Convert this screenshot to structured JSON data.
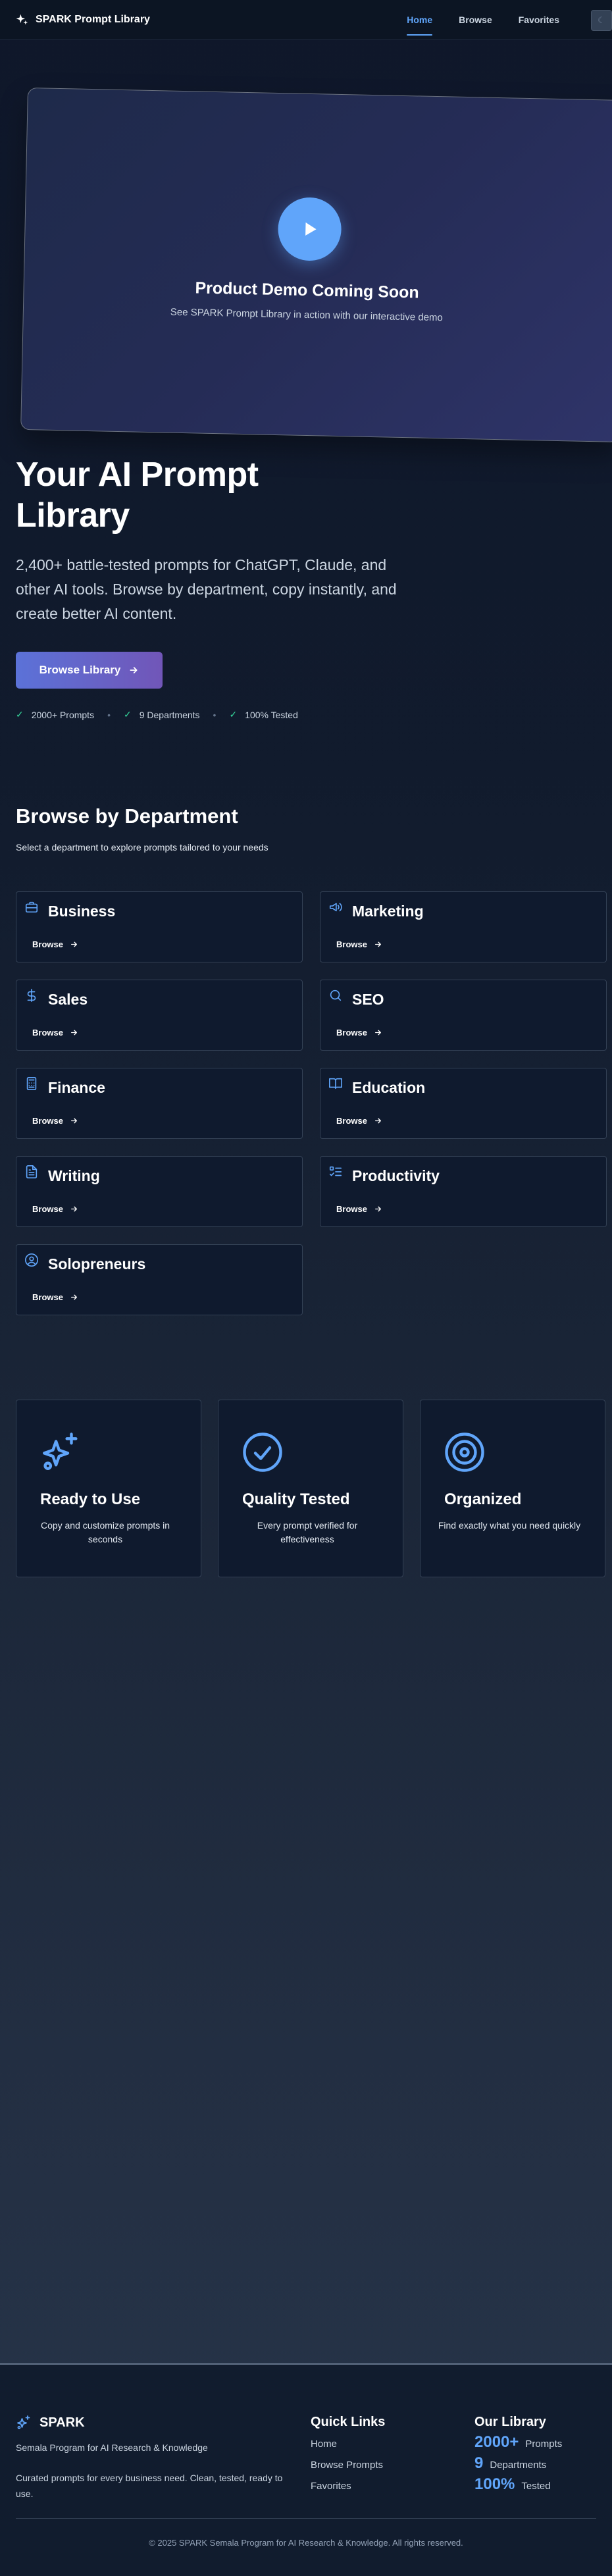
{
  "header": {
    "brand": "SPARK Prompt Library",
    "nav": [
      "Home",
      "Browse",
      "Favorites"
    ],
    "active_nav": "Home",
    "theme_icon": "moon-icon"
  },
  "demo": {
    "title": "Product Demo Coming Soon",
    "subtitle": "See SPARK Prompt Library in action with our interactive demo",
    "icon": "play-icon"
  },
  "hero": {
    "title_line1": "Your AI Prompt",
    "title_line2": "Library",
    "description": "2,400+ battle-tested prompts for ChatGPT, Claude, and other AI tools. Browse by department, copy instantly, and create better AI content.",
    "cta": "Browse Library",
    "stats": [
      "2000+ Prompts",
      "9 Departments",
      "100% Tested"
    ]
  },
  "departments": {
    "title": "Browse by Department",
    "subtitle": "Select a department to explore prompts tailored to your needs",
    "browse_label": "Browse",
    "items": [
      {
        "name": "Business",
        "icon": "briefcase-icon"
      },
      {
        "name": "Marketing",
        "icon": "megaphone-icon"
      },
      {
        "name": "Sales",
        "icon": "dollar-icon"
      },
      {
        "name": "SEO",
        "icon": "search-icon"
      },
      {
        "name": "Finance",
        "icon": "calculator-icon"
      },
      {
        "name": "Education",
        "icon": "book-open-icon"
      },
      {
        "name": "Writing",
        "icon": "document-icon"
      },
      {
        "name": "Productivity",
        "icon": "checklist-icon"
      },
      {
        "name": "Solopreneurs",
        "icon": "user-circle-icon"
      }
    ]
  },
  "features": [
    {
      "title": "Ready to Use",
      "desc": "Copy and customize prompts in seconds",
      "icon": "sparkles-icon"
    },
    {
      "title": "Quality Tested",
      "desc": "Every prompt verified for effectiveness",
      "icon": "check-circle-icon"
    },
    {
      "title": "Organized",
      "desc": "Find exactly what you need quickly",
      "icon": "target-icon"
    }
  ],
  "footer": {
    "brand": "SPARK",
    "org": "Semala Program for AI Research & Knowledge",
    "tagline": "Curated prompts for every business need. Clean, tested, ready to use.",
    "quick_links_title": "Quick Links",
    "quick_links": [
      "Home",
      "Browse Prompts",
      "Favorites"
    ],
    "library_title": "Our Library",
    "library_stats": [
      {
        "num": "2000+",
        "label": "Prompts"
      },
      {
        "num": "9",
        "label": "Departments"
      },
      {
        "num": "100%",
        "label": "Tested"
      }
    ],
    "copyright": "© 2025 SPARK Semala Program for AI Research & Knowledge. All rights reserved."
  },
  "colors": {
    "accent": "#60a5fa",
    "background": "#0f172a",
    "card": "#0f1a2e",
    "check": "#34d399",
    "button_gradient_start": "#5b72d8",
    "button_gradient_end": "#7156b8"
  }
}
